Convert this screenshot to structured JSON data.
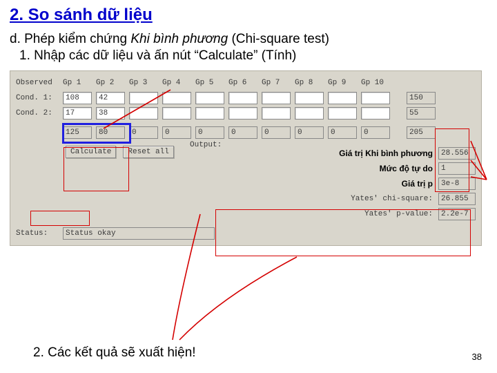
{
  "title": "2. So sánh dữ liệu",
  "line_d_prefix": "d. Phép kiểm chứng ",
  "line_d_italic": "Khi bình phương",
  "line_d_suffix": " (Chi-square test)",
  "line_1": "1. Nhập các dữ liệu và ấn nút “Calculate” (Tính)",
  "line_2": "2. Các kết quả sẽ xuất hiện!",
  "page_number": "38",
  "panel": {
    "observed_label": "Observed",
    "headers": [
      "Gp 1",
      "Gp 2",
      "Gp 3",
      "Gp 4",
      "Gp 5",
      "Gp 6",
      "Gp 7",
      "Gp 8",
      "Gp 9",
      "Gp 10"
    ],
    "cond1_label": "Cond. 1:",
    "cond1": [
      "108",
      "42",
      "",
      "",
      "",
      "",
      "",
      "",
      "",
      ""
    ],
    "cond1_total": "150",
    "cond2_label": "Cond. 2:",
    "cond2": [
      "17",
      "38",
      "",
      "",
      "",
      "",
      "",
      "",
      "",
      ""
    ],
    "cond2_total": "55",
    "totals": [
      "125",
      "80",
      "0",
      "0",
      "0",
      "0",
      "0",
      "0",
      "0",
      "0"
    ],
    "grand_total": "205",
    "output_label": "Output:",
    "calc_btn": "Calculate",
    "reset_btn": "Reset all",
    "out": {
      "chi_label": "Giá trị Khi bình phương",
      "chi_val": "28.556",
      "df_label": "Mức độ tự do",
      "df_val": "1",
      "p_label": "Giá trị p",
      "p_val": "3e-8",
      "yates_chi_label": "Yates' chi-square:",
      "yates_chi_val": "26.855",
      "yates_p_label": "Yates' p-value:",
      "yates_p_val": "2.2e-7"
    },
    "status_label": "Status:",
    "status_val": "Status okay"
  }
}
